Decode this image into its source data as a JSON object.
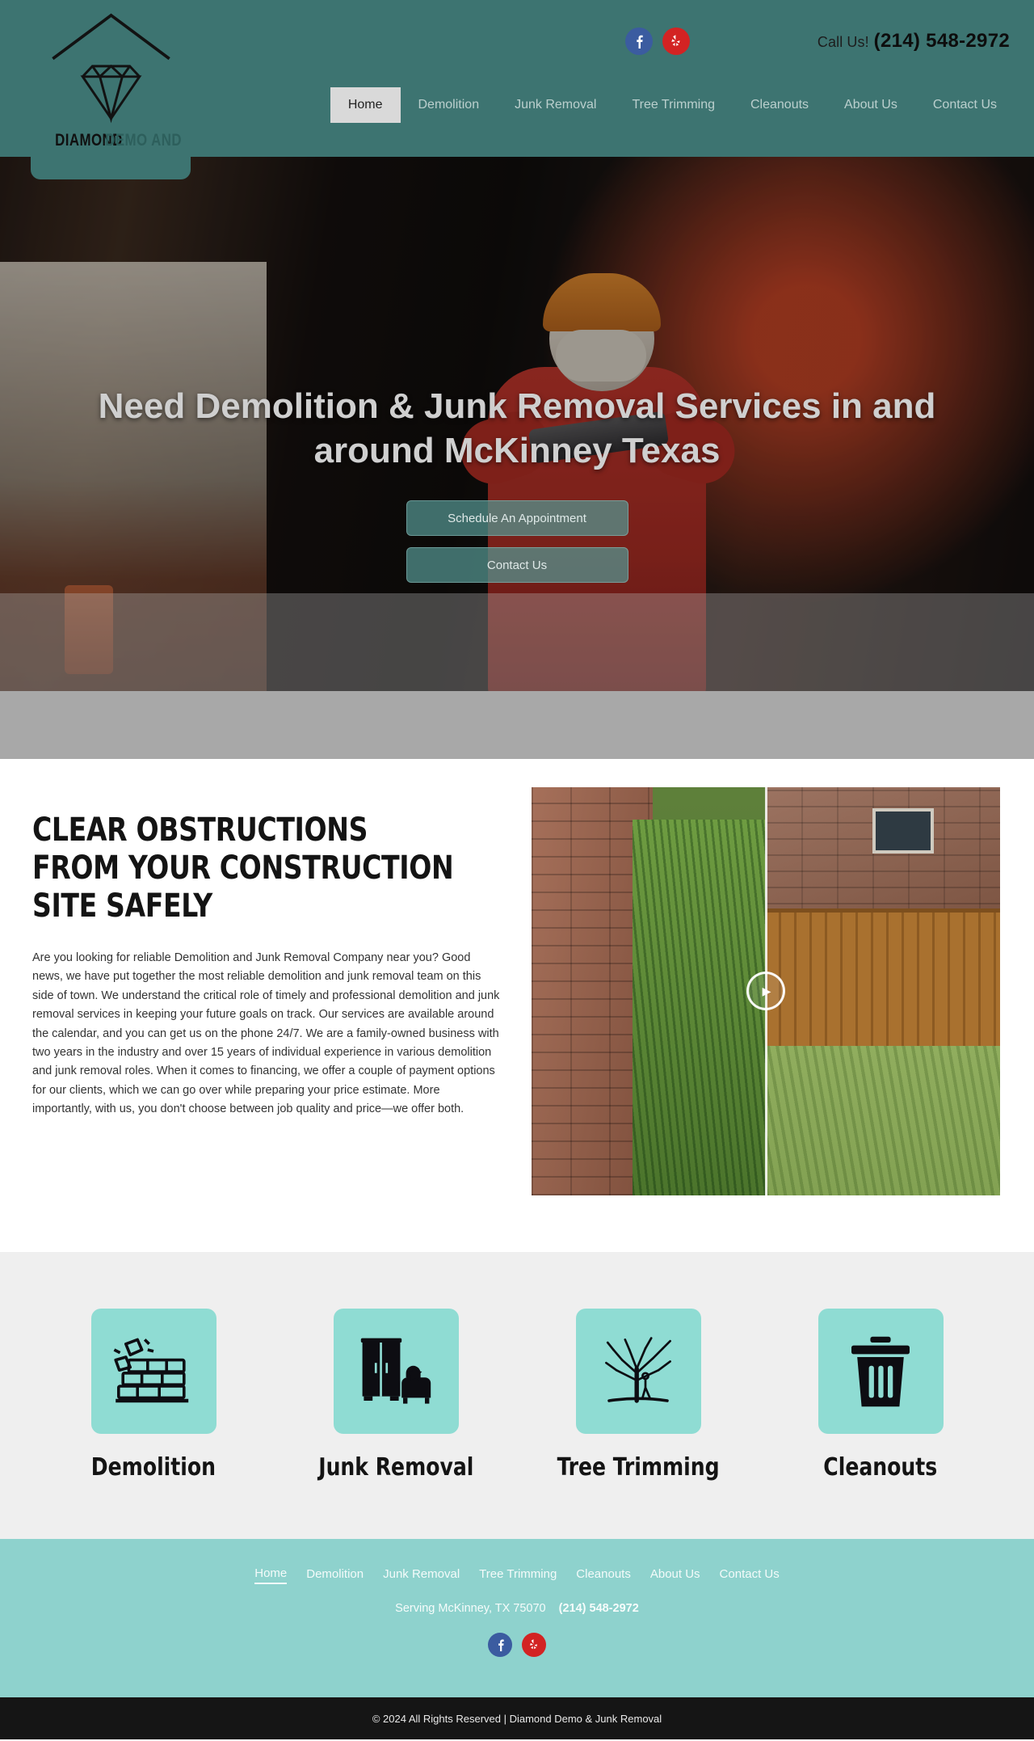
{
  "header": {
    "logo": {
      "brand_top": "DIAMOND",
      "brand_rest": "DEMO AND JUNK",
      "icon": "diamond-logo"
    },
    "social": [
      {
        "name": "facebook",
        "glyph": "f",
        "color": "#3b5ca0"
      },
      {
        "name": "yelp",
        "glyph": "✱",
        "color": "#d32323"
      }
    ],
    "call_label": "Call Us!",
    "call_number": "(214) 548-2972",
    "nav": [
      {
        "label": "Home",
        "active": true
      },
      {
        "label": "Demolition",
        "active": false
      },
      {
        "label": "Junk Removal",
        "active": false
      },
      {
        "label": "Tree Trimming",
        "active": false
      },
      {
        "label": "Cleanouts",
        "active": false
      },
      {
        "label": "About Us",
        "active": false
      },
      {
        "label": "Contact Us",
        "active": false
      }
    ]
  },
  "hero": {
    "title": "Need Demolition & Junk Removal Services in and around McKinney Texas",
    "buttons": [
      {
        "label": "Schedule An Appointment"
      },
      {
        "label": "Contact Us"
      }
    ]
  },
  "about": {
    "title": "CLEAR OBSTRUCTIONS FROM YOUR CONSTRUCTION SITE SAFELY",
    "paragraph": "Are you looking for reliable Demolition and Junk Removal Company near you? Good news, we have put together the most reliable demolition and junk removal team on this side of town. We understand the critical role of timely and professional demolition and junk removal services in keeping your future goals on track. Our services are available around the calendar, and you can get us on the phone 24/7. We are a family-owned business with two years in the industry and over 15 years of individual experience in various demolition and junk removal roles. When it comes to financing, we offer a couple of payment options for our clients, which we can go over while preparing your price estimate. More importantly, with us, you don't choose between job quality and price—we offer both.",
    "media": {
      "type": "before-after-video",
      "play_control": "play-pause-handle"
    }
  },
  "services": [
    {
      "label": "Demolition",
      "icon": "brick-wall-demolition-icon"
    },
    {
      "label": "Junk Removal",
      "icon": "furniture-junk-icon"
    },
    {
      "label": "Tree Trimming",
      "icon": "tree-icon"
    },
    {
      "label": "Cleanouts",
      "icon": "trash-can-icon"
    }
  ],
  "footer": {
    "nav": [
      {
        "label": "Home",
        "active": true
      },
      {
        "label": "Demolition",
        "active": false
      },
      {
        "label": "Junk Removal",
        "active": false
      },
      {
        "label": "Tree Trimming",
        "active": false
      },
      {
        "label": "Cleanouts",
        "active": false
      },
      {
        "label": "About Us",
        "active": false
      },
      {
        "label": "Contact Us",
        "active": false
      }
    ],
    "serving": "Serving McKinney, TX 75070",
    "phone": "(214) 548-2972",
    "social": [
      {
        "name": "facebook",
        "glyph": "f",
        "color": "#3b5ca0"
      },
      {
        "name": "yelp",
        "glyph": "✱",
        "color": "#d32323"
      }
    ],
    "copyright": "© 2024 All Rights Reserved | Diamond Demo & Junk Removal"
  },
  "colors": {
    "header_teal": "#3d7471",
    "footer_teal": "#8ed2cd",
    "icon_tile": "#8fdcd3",
    "copyright_bg": "#151515"
  }
}
